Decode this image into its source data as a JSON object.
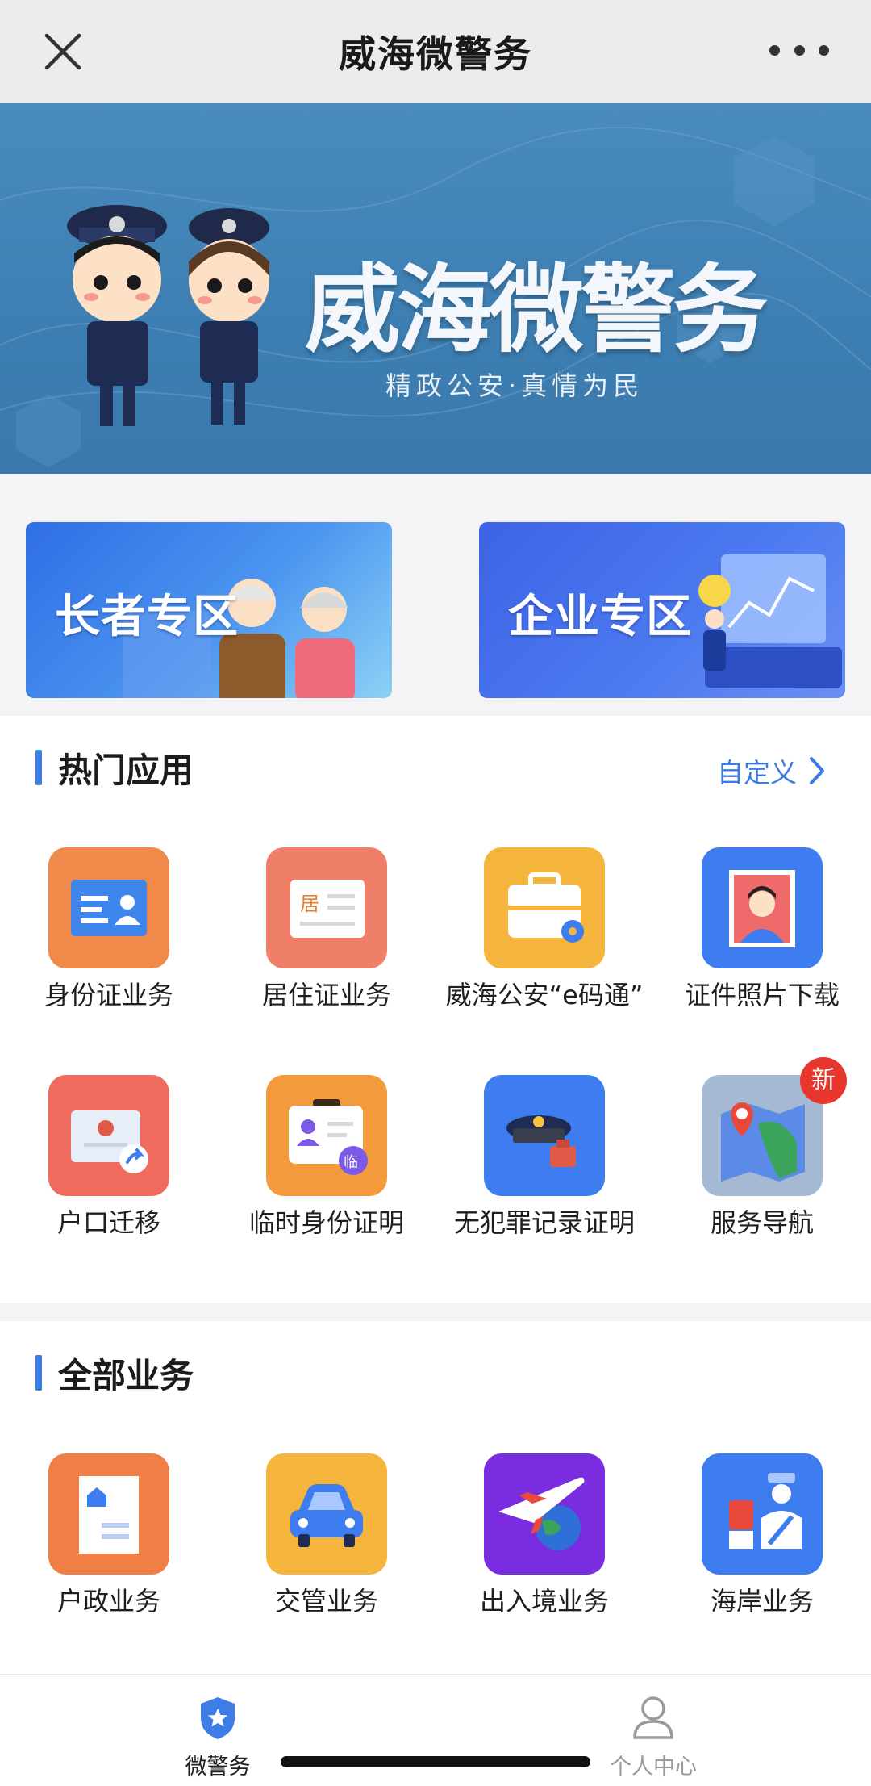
{
  "navbar": {
    "title": "威海微警务",
    "close_icon": "close-icon",
    "more_icon": "more-dots-icon"
  },
  "hero": {
    "title": "威海微警务",
    "subtitle": "精政公安·真情为民"
  },
  "promos": [
    {
      "label": "长者专区"
    },
    {
      "label": "企业专区"
    }
  ],
  "hot_apps": {
    "title": "热门应用",
    "customize_label": "自定义",
    "items": [
      {
        "label": "身份证业务",
        "icon": "id-card-icon",
        "color": "#f08a4b"
      },
      {
        "label": "居住证业务",
        "icon": "residence-permit-icon",
        "color": "#f07f6a"
      },
      {
        "label": "威海公安“e码通”",
        "icon": "briefcase-icon",
        "color": "#f5b43c"
      },
      {
        "label": "证件照片下载",
        "icon": "photo-download-icon",
        "color": "#3e7df0"
      },
      {
        "label": "户口迁移",
        "icon": "household-transfer-icon",
        "color": "#ef6b5d"
      },
      {
        "label": "临时身份证明",
        "icon": "temporary-id-icon",
        "color": "#f39a3c"
      },
      {
        "label": "无犯罪记录证明",
        "icon": "police-cap-icon",
        "color": "#3e7df0"
      },
      {
        "label": "服务导航",
        "icon": "map-pin-icon",
        "color": "#a6b9d3",
        "badge": "新"
      }
    ]
  },
  "all_services": {
    "title": "全部业务",
    "items": [
      {
        "label": "户政业务",
        "icon": "household-doc-icon",
        "color": "#ef7f45"
      },
      {
        "label": "交管业务",
        "icon": "car-icon",
        "color": "#f5b43c"
      },
      {
        "label": "出入境业务",
        "icon": "airplane-icon",
        "color": "#7a2de0"
      },
      {
        "label": "海岸业务",
        "icon": "coast-guard-icon",
        "color": "#3e7df0"
      }
    ]
  },
  "tabbar": {
    "items": [
      {
        "label": "微警务",
        "icon": "police-badge-icon",
        "active": true
      },
      {
        "label": "个人中心",
        "icon": "person-icon",
        "active": false
      }
    ]
  }
}
